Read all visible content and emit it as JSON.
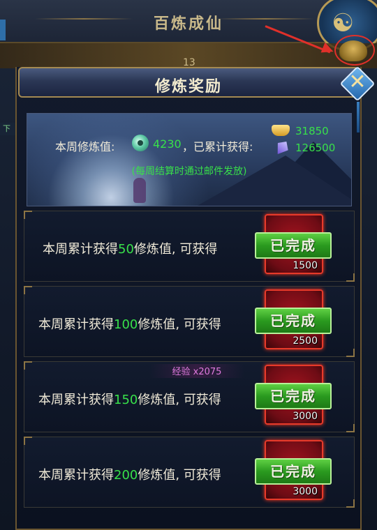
{
  "background": {
    "window_title": "百炼成仙",
    "strip_number": "13",
    "side_tab": "下"
  },
  "panel": {
    "title": "修炼奖励",
    "close_icon": "close-x-icon"
  },
  "summary": {
    "weekly_label": "本周修炼值:",
    "weekly_value": "4230",
    "accumulated_label": "，已累计获得:",
    "gold_value": "31850",
    "crystal_value": "126500",
    "note": "(每周结算时通过邮件发放)"
  },
  "rows": [
    {
      "prefix": "本周累计获得",
      "threshold": "50",
      "suffix": "修炼值, 可获得",
      "reward_count": "1500",
      "status": "已完成"
    },
    {
      "prefix": "本周累计获得",
      "threshold": "100",
      "suffix": "修炼值, 可获得",
      "reward_count": "2500",
      "status": "已完成"
    },
    {
      "prefix": "本周累计获得",
      "threshold": "150",
      "suffix": "修炼值, 可获得",
      "reward_count": "3000",
      "status": "已完成"
    },
    {
      "prefix": "本周累计获得",
      "threshold": "200",
      "suffix": "修炼值, 可获得",
      "reward_count": "3000",
      "status": "已完成"
    }
  ],
  "toast": "经验  x2075",
  "colors": {
    "accent_green": "#38e04a",
    "frame_gold": "#a48a52",
    "reward_red": "#e83a2a"
  }
}
